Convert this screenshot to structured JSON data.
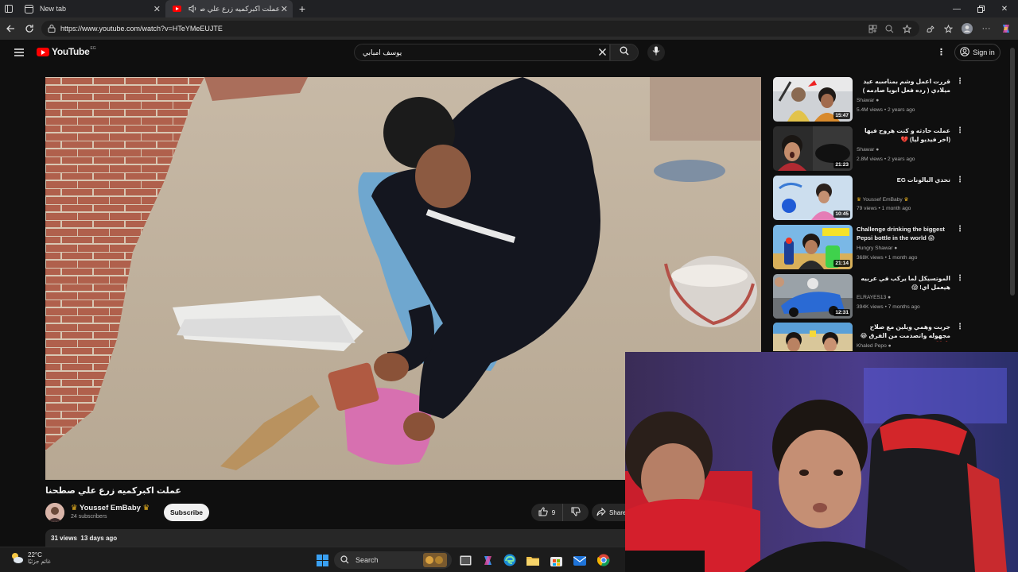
{
  "browser": {
    "tabs": [
      {
        "title": "New tab",
        "icon": "new-tab-icon"
      },
      {
        "title": "عملت اكبركميه زرع علي صطح…",
        "icon": "youtube-favicon"
      }
    ],
    "url": "https://www.youtube.com/watch?v=HTeYMeEUJTE"
  },
  "youtube": {
    "logo_text": "YouTube",
    "country_code": "EG",
    "search_value": "يوسف امبابي",
    "sign_in_label": "Sign in"
  },
  "video": {
    "title": "عملت اكبركميه زرع علي صطحنا",
    "channel": "Youssef EmBaby",
    "subscribers": "24 subscribers",
    "subscribe_label": "Subscribe",
    "likes": "9",
    "share_label": "Share",
    "views": "31 views",
    "age": "13 days ago"
  },
  "recommendations": [
    {
      "title": "قررت اعمل وشم بمناسبه عيد ميلادي ( رده فعل ابويا صادمه )",
      "channel": "Shawar",
      "verified": true,
      "views": "5.4M views",
      "age": "2 years ago",
      "duration": "15:47"
    },
    {
      "title": "عملت حادثه و كنت هروح فيها (اخر فيديو ليا) 💔",
      "channel": "Shawar",
      "verified": true,
      "views": "2.8M views",
      "age": "2 years ago",
      "duration": "21:23"
    },
    {
      "title": "تحدي البالونات EG",
      "channel": "Youssef EmBaby",
      "verified": false,
      "views": "79 views",
      "age": "1 month ago",
      "duration": "10:45"
    },
    {
      "title": "Challenge drinking the biggest Pepsi bottle in the world 😱",
      "channel": "Hungry Shawar",
      "verified": true,
      "views": "368K views",
      "age": "1 month ago",
      "duration": "21:14"
    },
    {
      "title": "الموتسيكل لما يركب في عربيه هيعمل اي! 😱",
      "channel": "ELRAYES13",
      "verified": true,
      "views": "394K views",
      "age": "7 months ago",
      "duration": "12:31"
    },
    {
      "title": "جربت وهمي ويلين مع صلاح مجهوله واتصدمت من الفرق 😂🔥❤️",
      "channel": "Khaled Pepo",
      "verified": true,
      "views": "",
      "age": "",
      "duration": ""
    }
  ],
  "taskbar": {
    "temperature": "22°C",
    "weather_desc": "غائم جزئيًا",
    "search_label": "Search"
  },
  "colors": {
    "yt_red": "#ff0000",
    "background": "#0f0f0f",
    "chip": "#272727"
  }
}
